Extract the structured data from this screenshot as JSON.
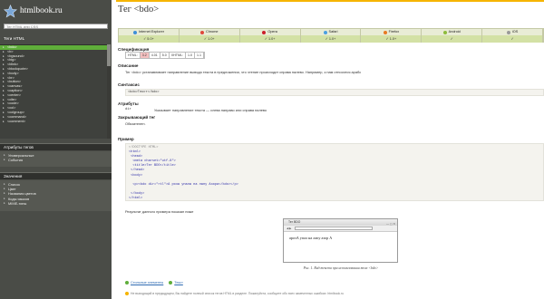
{
  "logo": {
    "text": "htmlbook.ru"
  },
  "search": {
    "placeholder": "Тег HTML или CSS"
  },
  "sidebar": {
    "tags_title": "Теги HTML",
    "tags": [
      "<bdo>",
      "<b>",
      "<bgsound>",
      "<big>",
      "<blink>",
      "<blockquote>",
      "<body>",
      "<br>",
      "<button>",
      "<canvas>",
      "<caption>",
      "<center>",
      "<cite>",
      "<code>",
      "<col>",
      "<colgroup>",
      "<command>",
      "<comment>"
    ],
    "active_tag_index": 0,
    "attrs_title": "Атрибуты тегов",
    "attrs_items": [
      "Универсальные",
      "События"
    ],
    "values_title": "Значения",
    "values_items": [
      "Список",
      "Цвет",
      "Названия цветов",
      "Коды языков",
      "MIME-типы"
    ]
  },
  "main": {
    "title": "Тег <bdo>",
    "browsers": [
      {
        "name": "Internet Explorer",
        "version": "✓ 5.0+",
        "color": "#3d8fd8"
      },
      {
        "name": "Chrome",
        "version": "✓ 1.0+",
        "color": "#e0473a"
      },
      {
        "name": "Opera",
        "version": "✓ 1.0+",
        "color": "#cc1f2a"
      },
      {
        "name": "Safari",
        "version": "✓ 1.0+",
        "color": "#4a9fe0"
      },
      {
        "name": "Firefox",
        "version": "✓ 1.0+",
        "color": "#e77a22"
      },
      {
        "name": "Android",
        "version": "✓",
        "color": "#8dbc3a"
      },
      {
        "name": "iOS",
        "version": "✓",
        "color": "#9a9a9a"
      }
    ],
    "spec": {
      "heading": "Спецификация",
      "html_label": "HTML:",
      "html_versions": [
        "3.2",
        "4.01",
        "5.0"
      ],
      "xhtml_label": "XHTML:",
      "xhtml_versions": [
        "1.0",
        "1.1"
      ]
    },
    "desc": {
      "heading": "Описание",
      "text": "Тег <bdo> устанавливает направление вывода текста в предложении, что чтение происходит справа налево. Например, к нам относятся арабс"
    },
    "syntax": {
      "heading": "Синтаксис",
      "code": "<bdo>Текст</bdo>"
    },
    "attributes": {
      "heading": "Атрибуты",
      "name": "dir",
      "desc": "Указывает направление текста — слева направо или справа налево"
    },
    "closing": {
      "heading": "Закрывающий тег",
      "value": "Обязателен."
    },
    "example": {
      "heading": "Пример",
      "lines": [
        "<!DOCTYPE HTML>",
        "<html>",
        " <head>",
        "  <meta charset=\"utf-8\">",
        "  <title>Тег BDO</title>",
        " </head>",
        " <body>",
        "",
        "  <p><bdo dir=\"rtl\">А роза упала на лапу Азора</bdo></p>",
        "",
        " </body>",
        "</html>"
      ]
    },
    "result_text": "Результат данного примера показан ниже",
    "result_window": {
      "title": "Тег BDO",
      "content": "арозА упал на лапу азор А"
    },
    "caption": "Рис. 1. Вид текста при использовании тега <bdo>",
    "links": {
      "similar": "Стильные элементы",
      "more": "Текст"
    },
    "footer": "Не выходящий в предыдущем, Вы найдете полный список тегов HTML в разделе. Пожалуйста, сообщите обо всех замеченных ошибках: htmlbook.ru"
  }
}
